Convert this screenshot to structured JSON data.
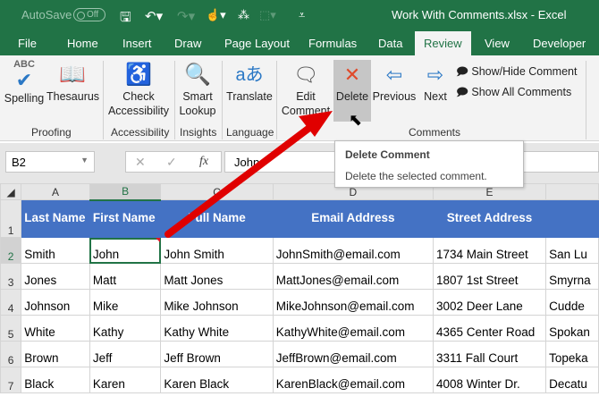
{
  "titlebar": {
    "autosave": "AutoSave",
    "autosave_state": "Off",
    "window_title": "Work With Comments.xlsx  -  Excel"
  },
  "tabs": [
    "File",
    "Home",
    "Insert",
    "Draw",
    "Page Layout",
    "Formulas",
    "Data",
    "Review",
    "View",
    "Developer"
  ],
  "active_tab": "Review",
  "ribbon": {
    "spelling": "Spelling",
    "thesaurus": "Thesaurus",
    "proofing": "Proofing",
    "check": "Check",
    "accessibility_btn": "Accessibility",
    "accessibility": "Accessibility",
    "smart": "Smart",
    "lookup": "Lookup",
    "insights": "Insights",
    "translate": "Translate",
    "language": "Language",
    "edit": "Edit",
    "comment": "Comment",
    "delete": "Delete",
    "previous": "Previous",
    "next": "Next",
    "show_hide": "Show/Hide Comment",
    "show_all": "Show All Comments",
    "comments": "Comments",
    "abc": "ABC"
  },
  "formula_bar": {
    "name_box": "B2",
    "cancel": "✕",
    "enter": "✓",
    "fx": "fx",
    "value": "John"
  },
  "tooltip": {
    "title": "Delete Comment",
    "desc": "Delete the selected comment."
  },
  "columns": [
    "A",
    "B",
    "C",
    "D",
    "E"
  ],
  "rows": [
    [
      "1",
      "Last Name",
      "First Name",
      "Full Name",
      "Email Address",
      "Street Address",
      ""
    ],
    [
      "2",
      "Smith",
      "John",
      "John Smith",
      "JohnSmith@email.com",
      "1734 Main Street",
      "San Lu"
    ],
    [
      "3",
      "Jones",
      "Matt",
      "Matt Jones",
      "MattJones@email.com",
      "1807 1st Street",
      "Smyrna"
    ],
    [
      "4",
      "Johnson",
      "Mike",
      "Mike Johnson",
      "MikeJohnson@email.com",
      "3002 Deer Lane",
      "Cudde"
    ],
    [
      "5",
      "White",
      "Kathy",
      "Kathy White",
      "KathyWhite@email.com",
      "4365 Center Road",
      "Spokan"
    ],
    [
      "6",
      "Brown",
      "Jeff",
      "Jeff Brown",
      "JeffBrown@email.com",
      "3311 Fall Court",
      "Topeka"
    ],
    [
      "7",
      "Black",
      "Karen",
      "Karen Black",
      "KarenBlack@email.com",
      "4008 Winter Dr.",
      "Decatu"
    ]
  ],
  "colors": {
    "excel_green": "#217346",
    "header_blue": "#4472c4",
    "arrow_red": "#e00000"
  }
}
